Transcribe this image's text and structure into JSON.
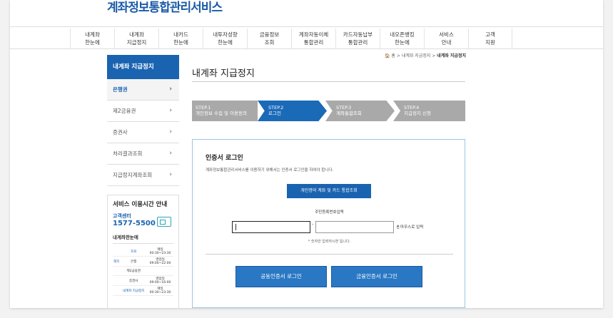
{
  "site": {
    "logo": "계좌정보통합관리서비스"
  },
  "gnb": [
    {
      "line1": "내계좌",
      "line2": "한눈에"
    },
    {
      "line1": "내계좌",
      "line2": "지급정지"
    },
    {
      "line1": "내카드",
      "line2": "한눈에"
    },
    {
      "line1": "내투자성향",
      "line2": "한눈에"
    },
    {
      "line1": "금융정보",
      "line2": "조회"
    },
    {
      "line1": "계좌자동이체",
      "line2": "통합관리"
    },
    {
      "line1": "카드자동납부",
      "line2": "통합관리"
    },
    {
      "line1": "내오픈뱅킹",
      "line2": "한눈에"
    },
    {
      "line1": "서비스",
      "line2": "안내"
    },
    {
      "line1": "고객",
      "line2": "지원"
    }
  ],
  "breadcrumb": {
    "home": "🏠 홈",
    "sep1": ">",
    "parent": "내계좌 지급정지",
    "sep2": ">",
    "current": "내계좌 지급정지"
  },
  "sidebar": {
    "title": "내계좌 지급정지",
    "items": [
      {
        "label": "은행권"
      },
      {
        "label": "제2금융권"
      },
      {
        "label": "증권사"
      },
      {
        "label": "처리결과조회"
      },
      {
        "label": "지급정지계좌조회"
      }
    ]
  },
  "service": {
    "title": "서비스 이용시간 안내",
    "center_label": "고객센터",
    "phone": "1577-5500",
    "sub_title": "내계좌한눈에",
    "rows": [
      {
        "group": "",
        "name": "조회",
        "days": "매일",
        "time": "00:30~23:30"
      },
      {
        "group": "해지",
        "name": "은행",
        "days": "영업일",
        "time": "09:00~22:00"
      },
      {
        "group": "",
        "name": "제2금융권",
        "days": "",
        "time": ""
      },
      {
        "group": "",
        "name": "증권사",
        "days": "영업일",
        "time": "09:00~16:00"
      },
      {
        "group": "",
        "name": "내계좌 지급정지",
        "days": "매일",
        "time": "00:30~23:30"
      }
    ]
  },
  "main": {
    "title": "내계좌 지급정지",
    "steps": [
      {
        "step": "STEP.1",
        "label": "개인정보 수집 및 이용동의"
      },
      {
        "step": "STEP.2",
        "label": "로그인"
      },
      {
        "step": "STEP.3",
        "label": "계좌통합조회"
      },
      {
        "step": "STEP.4",
        "label": "지급정지 신청"
      }
    ],
    "login": {
      "title": "인증서 로그인",
      "desc": "계좌정보통합관리서비스를 이용하기 위해서는 인증서 로그인을 하여야 합니다.",
      "cert_button": "개인명의 계좌 및 카드 통합조회",
      "rrn_label": "주민등록번호입력",
      "rrn_dash": "-",
      "mouse_input": "🖱 마우스로 입력",
      "hint": "* 숫자만 입력하시면 됩니다.",
      "btn_public_cert": "공동인증서 로그인",
      "btn_finance_cert": "금융인증서 로그인"
    }
  },
  "colors": {
    "primary": "#1a63b0",
    "step_active": "#1a6ab8",
    "step_inactive": "#a9a9a9",
    "button": "#2a78c4"
  }
}
